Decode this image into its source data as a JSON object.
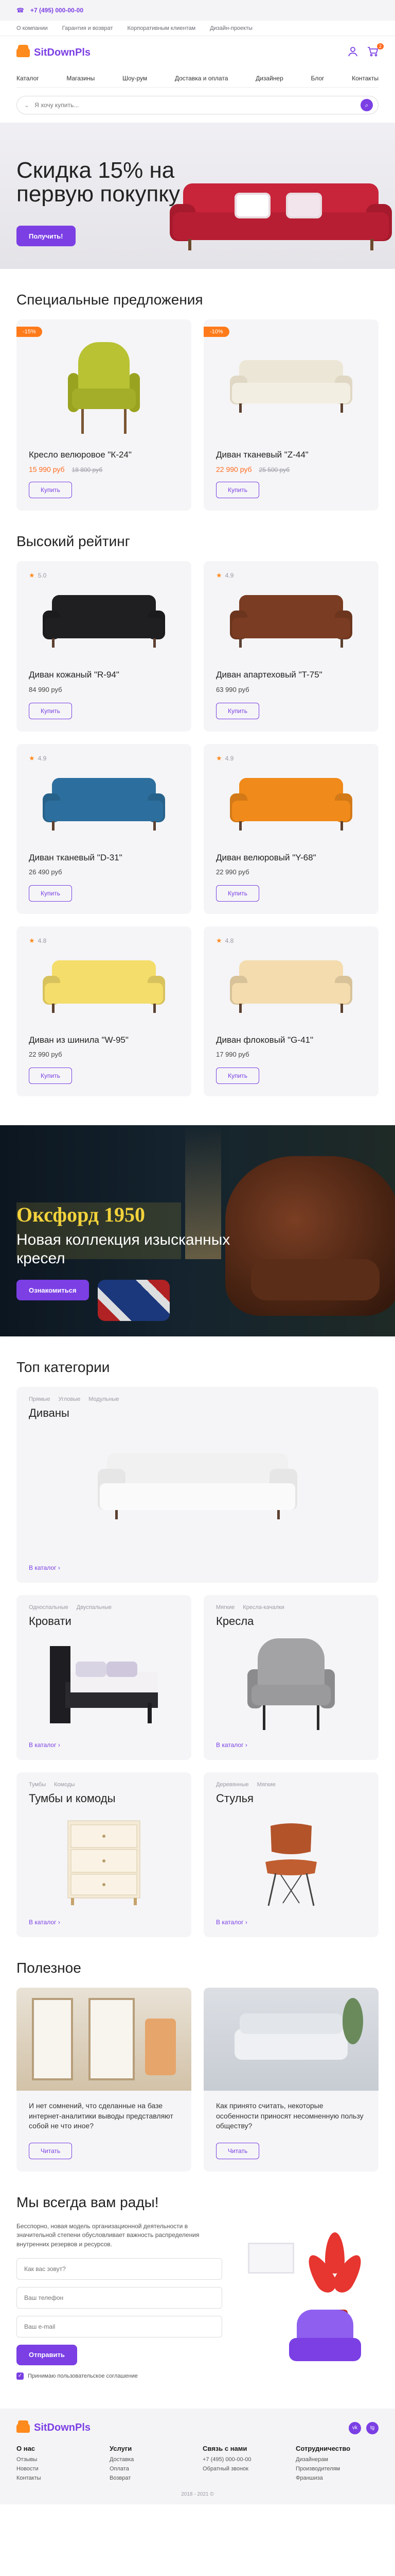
{
  "topbar": {
    "phone": "+7 (495) 000-00-00",
    "links": [
      "О компании",
      "Гарантия и возврат",
      "Корпоративным клиентам",
      "Дизайн-проекты"
    ]
  },
  "header": {
    "logo": "SitDownPls",
    "cart_count": "2"
  },
  "nav": [
    "Каталог",
    "Магазины",
    "Шоу-рум",
    "Доставка и оплата",
    "Дизайнер",
    "Блог",
    "Контакты"
  ],
  "search": {
    "placeholder": "Я хочу купить..."
  },
  "hero": {
    "title": "Скидка 15% на первую покупку",
    "button": "Получить!"
  },
  "special": {
    "title": "Специальные предложения",
    "buy_label": "Купить",
    "items": [
      {
        "badge": "-15%",
        "name": "Кресло велюровое \"К-24\"",
        "price": "15 990 руб",
        "old": "18 800 руб",
        "color": "#b8c233"
      },
      {
        "badge": "-10%",
        "name": "Диван тканевый \"Z-44\"",
        "price": "22 990 руб",
        "old": "25 500 руб",
        "color": "#ece6d6"
      }
    ]
  },
  "rated": {
    "title": "Высокий рейтинг",
    "buy_label": "Купить",
    "items": [
      {
        "rating": "5.0",
        "name": "Диван кожаный \"R-94\"",
        "price": "84 990 руб",
        "color": "#1f1f22"
      },
      {
        "rating": "4.9",
        "name": "Диван апартеховый \"T-75\"",
        "price": "63 990 руб",
        "color": "#7a3c22"
      },
      {
        "rating": "4.9",
        "name": "Диван тканевый \"D-31\"",
        "price": "26 490 руб",
        "color": "#2c6f9e"
      },
      {
        "rating": "4.9",
        "name": "Диван велюровый \"Y-68\"",
        "price": "22 990 руб",
        "color": "#f08a1a"
      },
      {
        "rating": "4.8",
        "name": "Диван из шинила \"W-95\"",
        "price": "22 990 руб",
        "color": "#f4dd6a"
      },
      {
        "rating": "4.8",
        "name": "Диван флоковый \"G-41\"",
        "price": "17 990 руб",
        "color": "#f4dcae"
      }
    ]
  },
  "promo": {
    "brand": "Оксфорд 1950",
    "text": "Новая коллекция изысканных кресел",
    "button": "Ознакомиться"
  },
  "categories": {
    "title": "Топ категории",
    "more_label": "В каталог",
    "items": [
      {
        "tags": [
          "Прямые",
          "Угловые",
          "Модульные"
        ],
        "name": "Диваны"
      },
      {
        "tags": [
          "Односпальные",
          "Двуспальные"
        ],
        "name": "Кровати"
      },
      {
        "tags": [
          "Мягкие",
          "Кресла-качалки"
        ],
        "name": "Кресла"
      },
      {
        "tags": [
          "Тумбы",
          "Комоды"
        ],
        "name": "Тумбы и комоды"
      },
      {
        "tags": [
          "Деревянные",
          "Мягкие"
        ],
        "name": "Стулья"
      }
    ]
  },
  "articles": {
    "title": "Полезное",
    "read_label": "Читать",
    "items": [
      {
        "text": "И нет сомнений, что сделанные на базе интернет-аналитики выводы представляют собой не что иное?"
      },
      {
        "text": "Как принято считать, некоторые особенности приносят несомненную пользу обществу?"
      }
    ]
  },
  "contact": {
    "title": "Мы всегда вам рады!",
    "lead": "Бесспорно, новая модель организационной деятельности в значительной степени обусловливает важность распределения внутренних резервов и ресурсов.",
    "name_placeholder": "Как вас зовут?",
    "phone_placeholder": "Ваш телефон",
    "email_placeholder": "Ваш e-mail",
    "submit": "Отправить",
    "consent": "Принимаю пользовательское соглашение"
  },
  "footer": {
    "logo": "SitDownPls",
    "socials": [
      "vk",
      "tg"
    ],
    "columns": [
      {
        "title": "О нас",
        "links": [
          "Отзывы",
          "Новости",
          "Контакты"
        ]
      },
      {
        "title": "Услуги",
        "links": [
          "Доставка",
          "Оплата",
          "Возврат"
        ]
      },
      {
        "title": "Связь с нами",
        "links": [
          "+7 (495) 000-00-00",
          "Обратный звонок"
        ]
      },
      {
        "title": "Сотрудничество",
        "links": [
          "Дизайнерам",
          "Производителям",
          "Франшиза"
        ]
      }
    ],
    "copyright": "2018 - 2021 ©"
  },
  "colors": {
    "accent": "#7b3fe4",
    "orange": "#ff6b1e"
  }
}
